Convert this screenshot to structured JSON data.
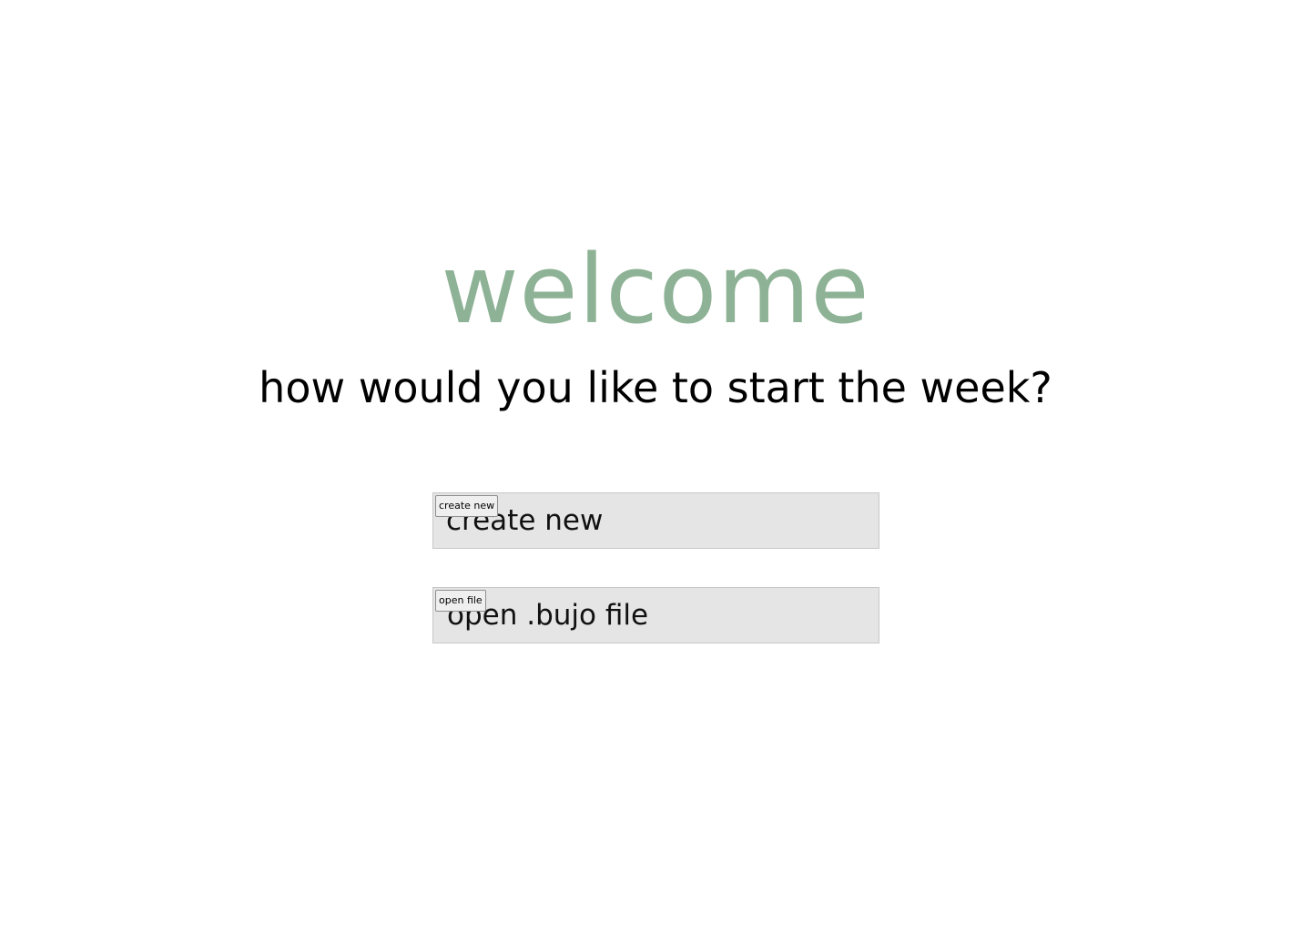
{
  "colors": {
    "welcome_title": "#8db295",
    "option_box_bg": "#e5e5e5",
    "page_bg": "#ffffff"
  },
  "header": {
    "title": "welcome",
    "subtitle": "how would you like to start the week?"
  },
  "options": {
    "create": {
      "button_label": "create new",
      "label": "create new"
    },
    "open": {
      "button_label": "open file",
      "label": "open .bujo file"
    }
  }
}
